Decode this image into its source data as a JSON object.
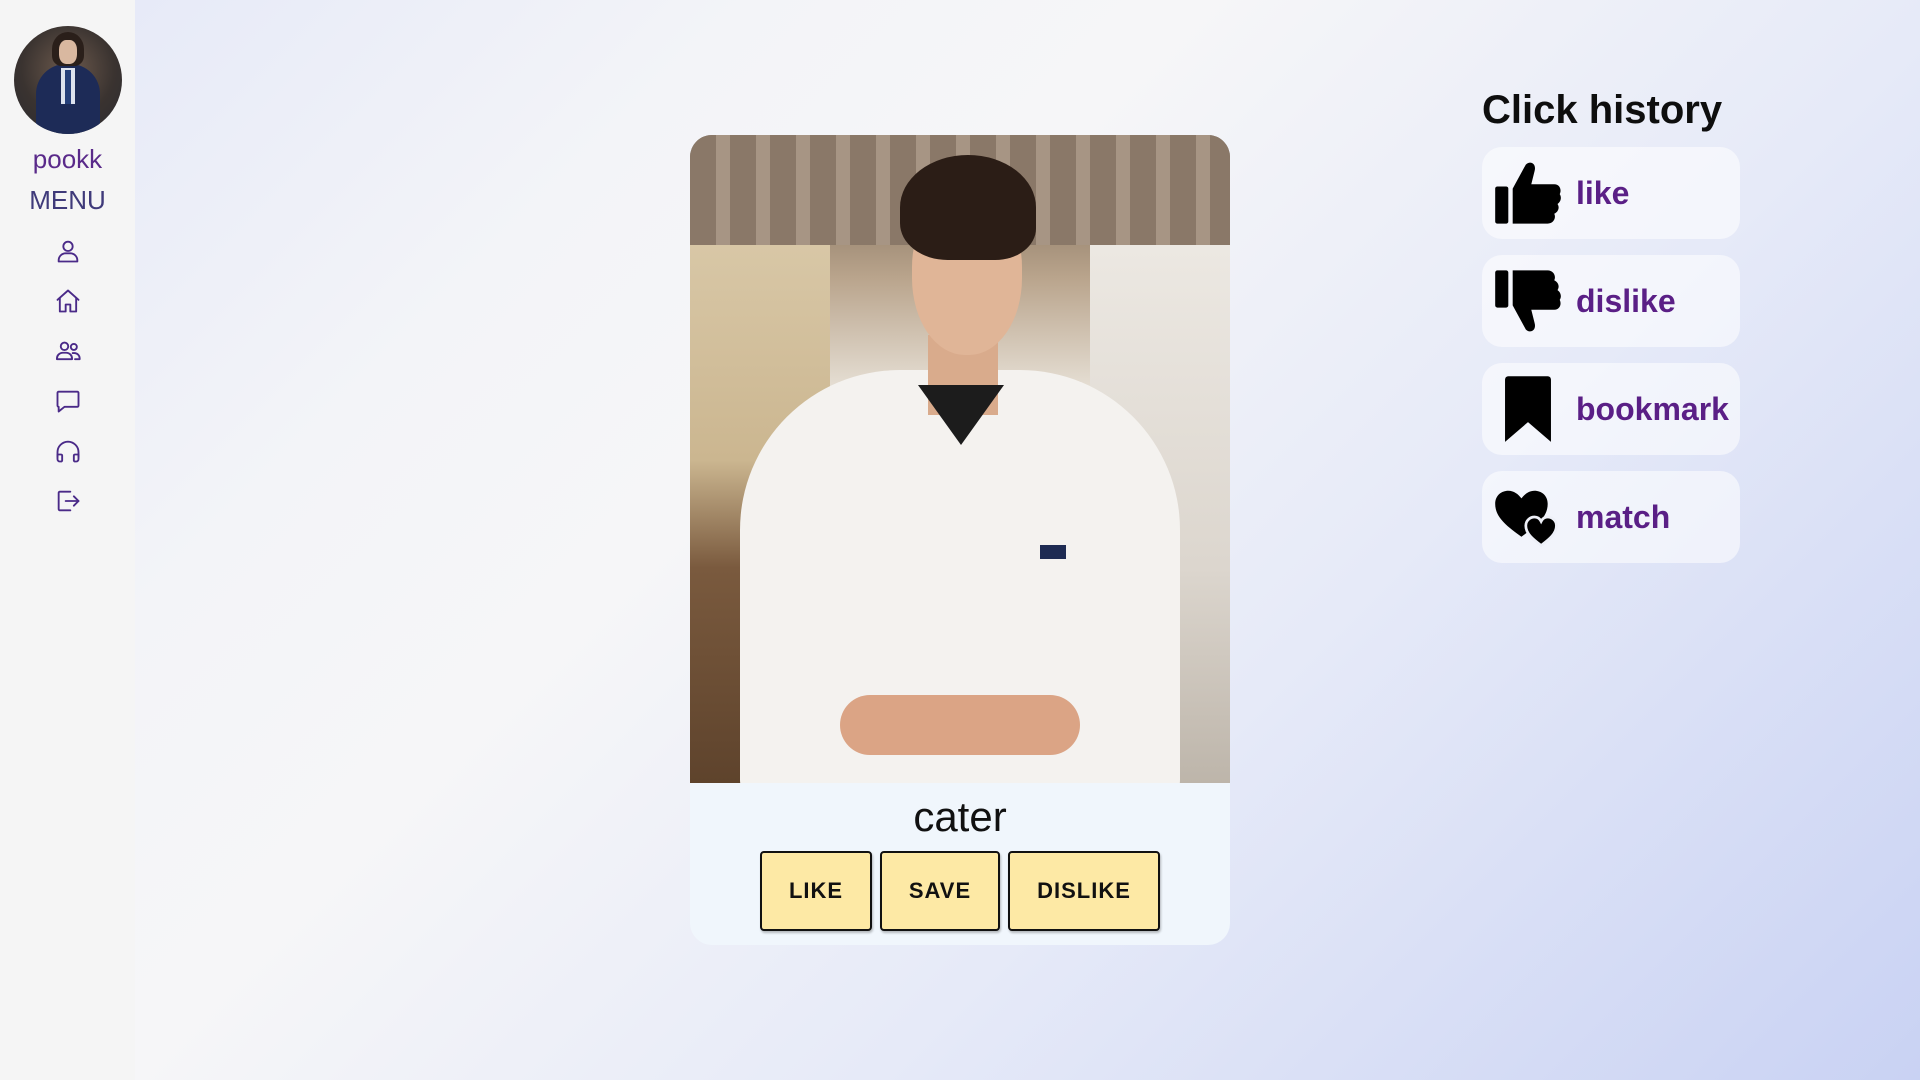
{
  "sidebar": {
    "username": "pookk",
    "menu_label": "MENU",
    "nav": [
      {
        "icon": "user-icon"
      },
      {
        "icon": "home-icon"
      },
      {
        "icon": "users-icon"
      },
      {
        "icon": "chat-icon"
      },
      {
        "icon": "headphones-icon"
      },
      {
        "icon": "logout-icon"
      }
    ]
  },
  "card": {
    "name": "cater",
    "buttons": {
      "like": "LIKE",
      "save": "SAVE",
      "dislike": "DISLIKE"
    }
  },
  "history": {
    "title": "Click history",
    "items": [
      {
        "label": "like",
        "icon": "thumbs-up-icon"
      },
      {
        "label": "dislike",
        "icon": "thumbs-down-icon"
      },
      {
        "label": "bookmark",
        "icon": "bookmark-icon"
      },
      {
        "label": "match",
        "icon": "hearts-icon"
      }
    ]
  },
  "colors": {
    "accent": "#5a1f86",
    "button_bg": "#fde9a5",
    "sidebar_bg": "#f5f5f5",
    "card_bg": "#f0f6fc"
  }
}
